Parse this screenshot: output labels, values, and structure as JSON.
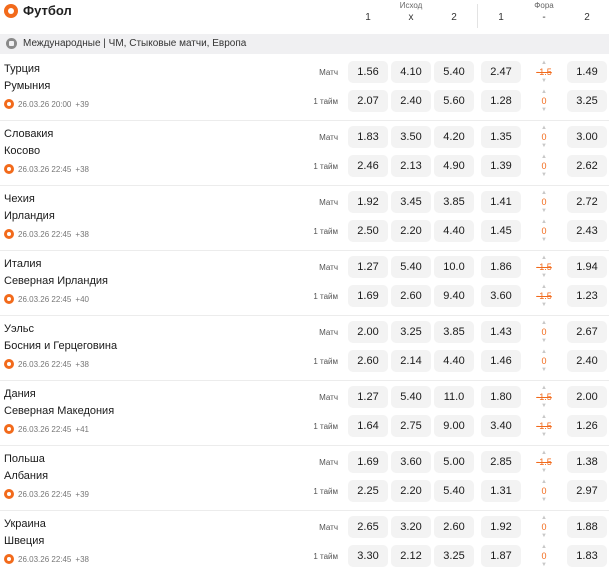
{
  "header": {
    "title": "Футбол",
    "group_outcome": "Исход",
    "group_handicap": "Фора",
    "cols": [
      "1",
      "x",
      "2",
      "1",
      "-",
      "2"
    ]
  },
  "league": "Международные | ЧМ, Стыковые матчи, Европа",
  "matches": [
    {
      "team1": "Турция",
      "team2": "Румыния",
      "date": "26.03.26 20:00",
      "more": "+39",
      "rows": [
        {
          "period": "Матч",
          "o1": "1.56",
          "ox": "4.10",
          "o2": "5.40",
          "h1": "2.47",
          "hv": "-1.5",
          "h2": "1.49"
        },
        {
          "period": "1 тайм",
          "o1": "2.07",
          "ox": "2.40",
          "o2": "5.60",
          "h1": "1.28",
          "hv": "0",
          "h2": "3.25"
        }
      ]
    },
    {
      "team1": "Словакия",
      "team2": "Косово",
      "date": "26.03.26 22:45",
      "more": "+38",
      "rows": [
        {
          "period": "Матч",
          "o1": "1.83",
          "ox": "3.50",
          "o2": "4.20",
          "h1": "1.35",
          "hv": "0",
          "h2": "3.00"
        },
        {
          "period": "1 тайм",
          "o1": "2.46",
          "ox": "2.13",
          "o2": "4.90",
          "h1": "1.39",
          "hv": "0",
          "h2": "2.62"
        }
      ]
    },
    {
      "team1": "Чехия",
      "team2": "Ирландия",
      "date": "26.03.26 22:45",
      "more": "+38",
      "rows": [
        {
          "period": "Матч",
          "o1": "1.92",
          "ox": "3.45",
          "o2": "3.85",
          "h1": "1.41",
          "hv": "0",
          "h2": "2.72"
        },
        {
          "period": "1 тайм",
          "o1": "2.50",
          "ox": "2.20",
          "o2": "4.40",
          "h1": "1.45",
          "hv": "0",
          "h2": "2.43"
        }
      ]
    },
    {
      "team1": "Италия",
      "team2": "Северная Ирландия",
      "date": "26.03.26 22:45",
      "more": "+40",
      "rows": [
        {
          "period": "Матч",
          "o1": "1.27",
          "ox": "5.40",
          "o2": "10.0",
          "h1": "1.86",
          "hv": "-1.5",
          "h2": "1.94"
        },
        {
          "period": "1 тайм",
          "o1": "1.69",
          "ox": "2.60",
          "o2": "9.40",
          "h1": "3.60",
          "hv": "-1.5",
          "h2": "1.23"
        }
      ]
    },
    {
      "team1": "Уэльс",
      "team2": "Босния и Герцеговина",
      "date": "26.03.26 22:45",
      "more": "+38",
      "rows": [
        {
          "period": "Матч",
          "o1": "2.00",
          "ox": "3.25",
          "o2": "3.85",
          "h1": "1.43",
          "hv": "0",
          "h2": "2.67"
        },
        {
          "period": "1 тайм",
          "o1": "2.60",
          "ox": "2.14",
          "o2": "4.40",
          "h1": "1.46",
          "hv": "0",
          "h2": "2.40"
        }
      ]
    },
    {
      "team1": "Дания",
      "team2": "Северная Македония",
      "date": "26.03.26 22:45",
      "more": "+41",
      "rows": [
        {
          "period": "Матч",
          "o1": "1.27",
          "ox": "5.40",
          "o2": "11.0",
          "h1": "1.80",
          "hv": "-1.5",
          "h2": "2.00"
        },
        {
          "period": "1 тайм",
          "o1": "1.64",
          "ox": "2.75",
          "o2": "9.00",
          "h1": "3.40",
          "hv": "-1.5",
          "h2": "1.26"
        }
      ]
    },
    {
      "team1": "Польша",
      "team2": "Албания",
      "date": "26.03.26 22:45",
      "more": "+39",
      "rows": [
        {
          "period": "Матч",
          "o1": "1.69",
          "ox": "3.60",
          "o2": "5.00",
          "h1": "2.85",
          "hv": "-1.5",
          "h2": "1.38"
        },
        {
          "period": "1 тайм",
          "o1": "2.25",
          "ox": "2.20",
          "o2": "5.40",
          "h1": "1.31",
          "hv": "0",
          "h2": "2.97"
        }
      ]
    },
    {
      "team1": "Украина",
      "team2": "Швеция",
      "date": "26.03.26 22:45",
      "more": "+38",
      "rows": [
        {
          "period": "Матч",
          "o1": "2.65",
          "ox": "3.20",
          "o2": "2.60",
          "h1": "1.92",
          "hv": "0",
          "h2": "1.88"
        },
        {
          "period": "1 тайм",
          "o1": "3.30",
          "ox": "2.12",
          "o2": "3.25",
          "h1": "1.87",
          "hv": "0",
          "h2": "1.83"
        }
      ]
    }
  ]
}
